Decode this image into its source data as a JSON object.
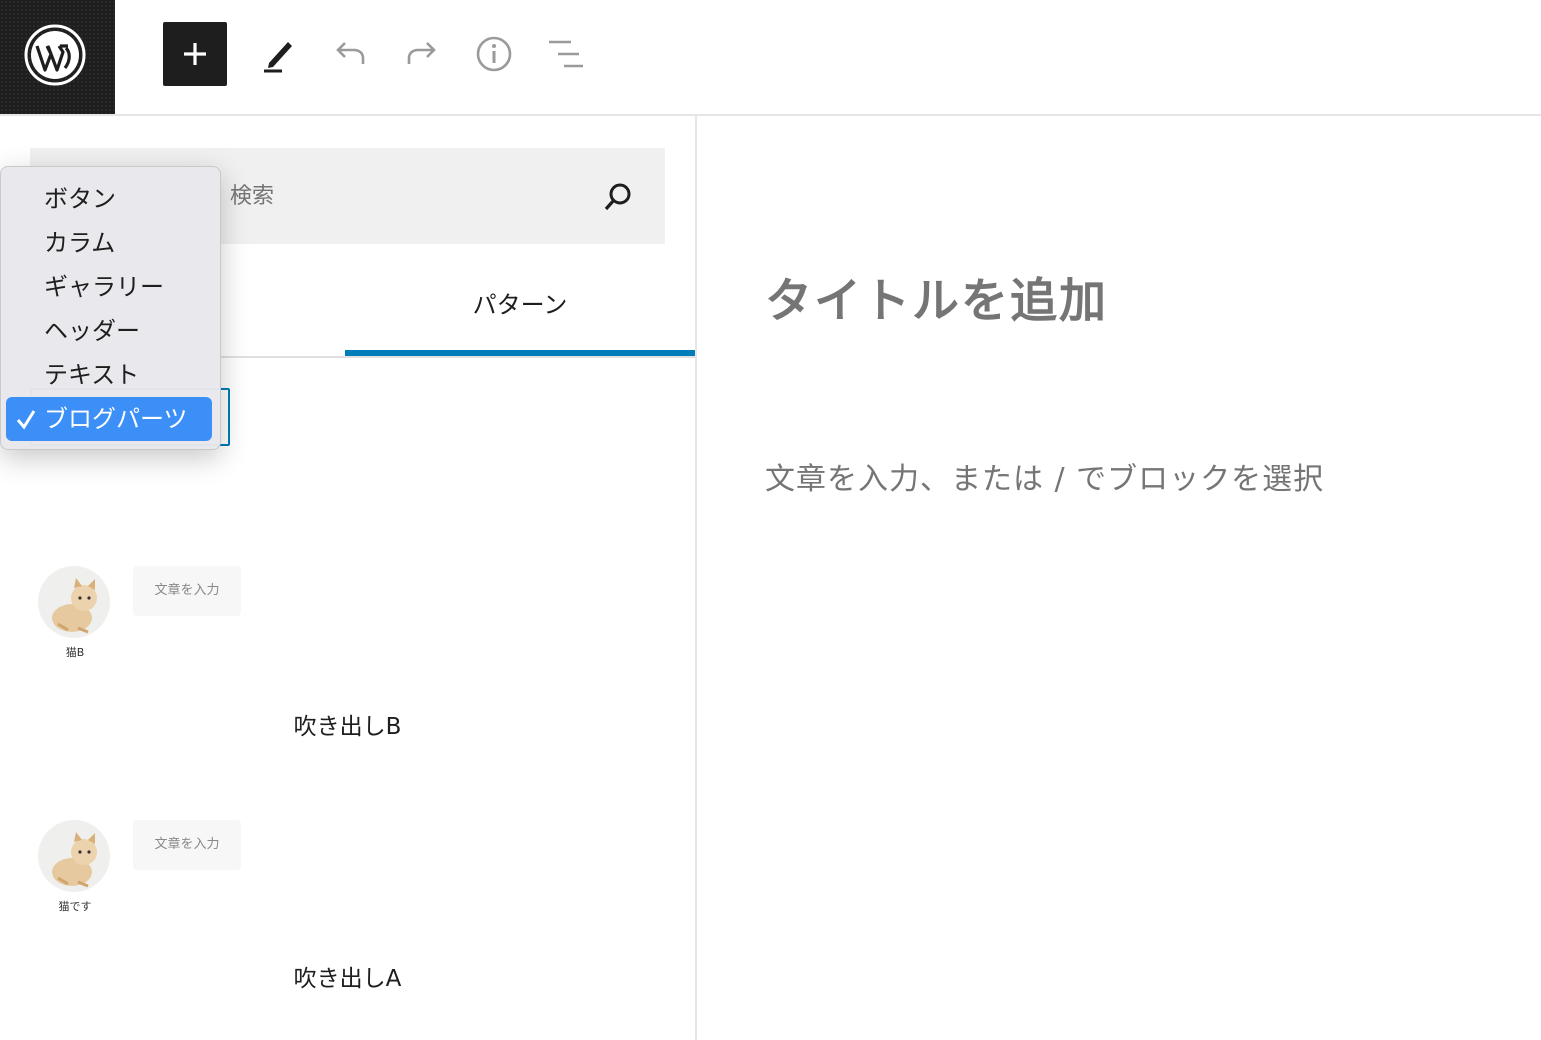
{
  "toolbar": {
    "logo_icon": "wordpress-logo-icon",
    "add_block_icon": "plus-icon",
    "tools_icon": "pencil-icon",
    "undo_icon": "undo-icon",
    "redo_icon": "redo-icon",
    "details_icon": "info-icon",
    "outline_icon": "list-view-icon"
  },
  "inserter": {
    "search_placeholder": "検索",
    "search_icon": "search-icon",
    "tabs": {
      "patterns": "パターン"
    },
    "category_dropdown": {
      "options": [
        "ボタン",
        "カラム",
        "ギャラリー",
        "ヘッダー",
        "テキスト",
        "ブログパーツ"
      ],
      "selected": "ブログパーツ"
    },
    "patterns": [
      {
        "avatar_name": "猫B",
        "bubble_text": "文章を入力",
        "title": "吹き出しB"
      },
      {
        "avatar_name": "猫です",
        "bubble_text": "文章を入力",
        "title": "吹き出しA"
      }
    ]
  },
  "editor": {
    "title_placeholder": "タイトルを追加",
    "block_placeholder": "文章を入力、または / でブロックを選択"
  },
  "colors": {
    "accent": "#007cba",
    "menu_selected": "#3b8ff6",
    "logo_bg": "#1e1e1e",
    "placeholder_text": "#757575"
  }
}
